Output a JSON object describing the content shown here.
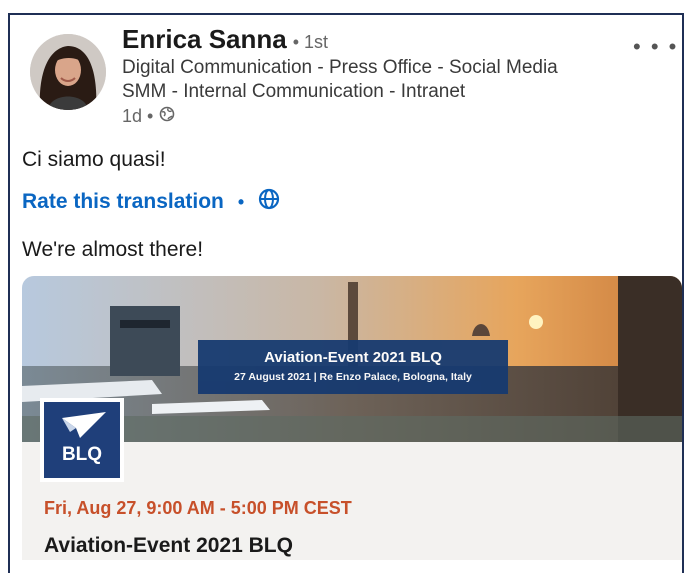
{
  "author": {
    "name": "Enrica Sanna",
    "degree": "• 1st",
    "headline_line1": "Digital Communication - Press Office - Social Media",
    "headline_line2": "SMM - Internal Communication - Intranet",
    "time": "1d •"
  },
  "post": {
    "text": "Ci siamo quasi!",
    "rate_label": "Rate this translation",
    "separator": "•",
    "translation": "We're almost there!"
  },
  "event_card": {
    "banner_title": "Aviation-Event 2021 BLQ",
    "banner_subtitle": "27 August 2021 | Re Enzo Palace, Bologna, Italy",
    "logo_text": "BLQ",
    "date": "Fri, Aug 27, 9:00 AM - 5:00 PM CEST",
    "title": "Aviation-Event 2021 BLQ"
  },
  "colors": {
    "link": "#0a66c2",
    "event_date": "#c7502a",
    "banner_box": "#173a70",
    "logo_bg": "#1f3f7a"
  },
  "icons": [
    "more-options-icon",
    "globe-icon",
    "translate-globe-icon",
    "blq-plane-logo"
  ]
}
